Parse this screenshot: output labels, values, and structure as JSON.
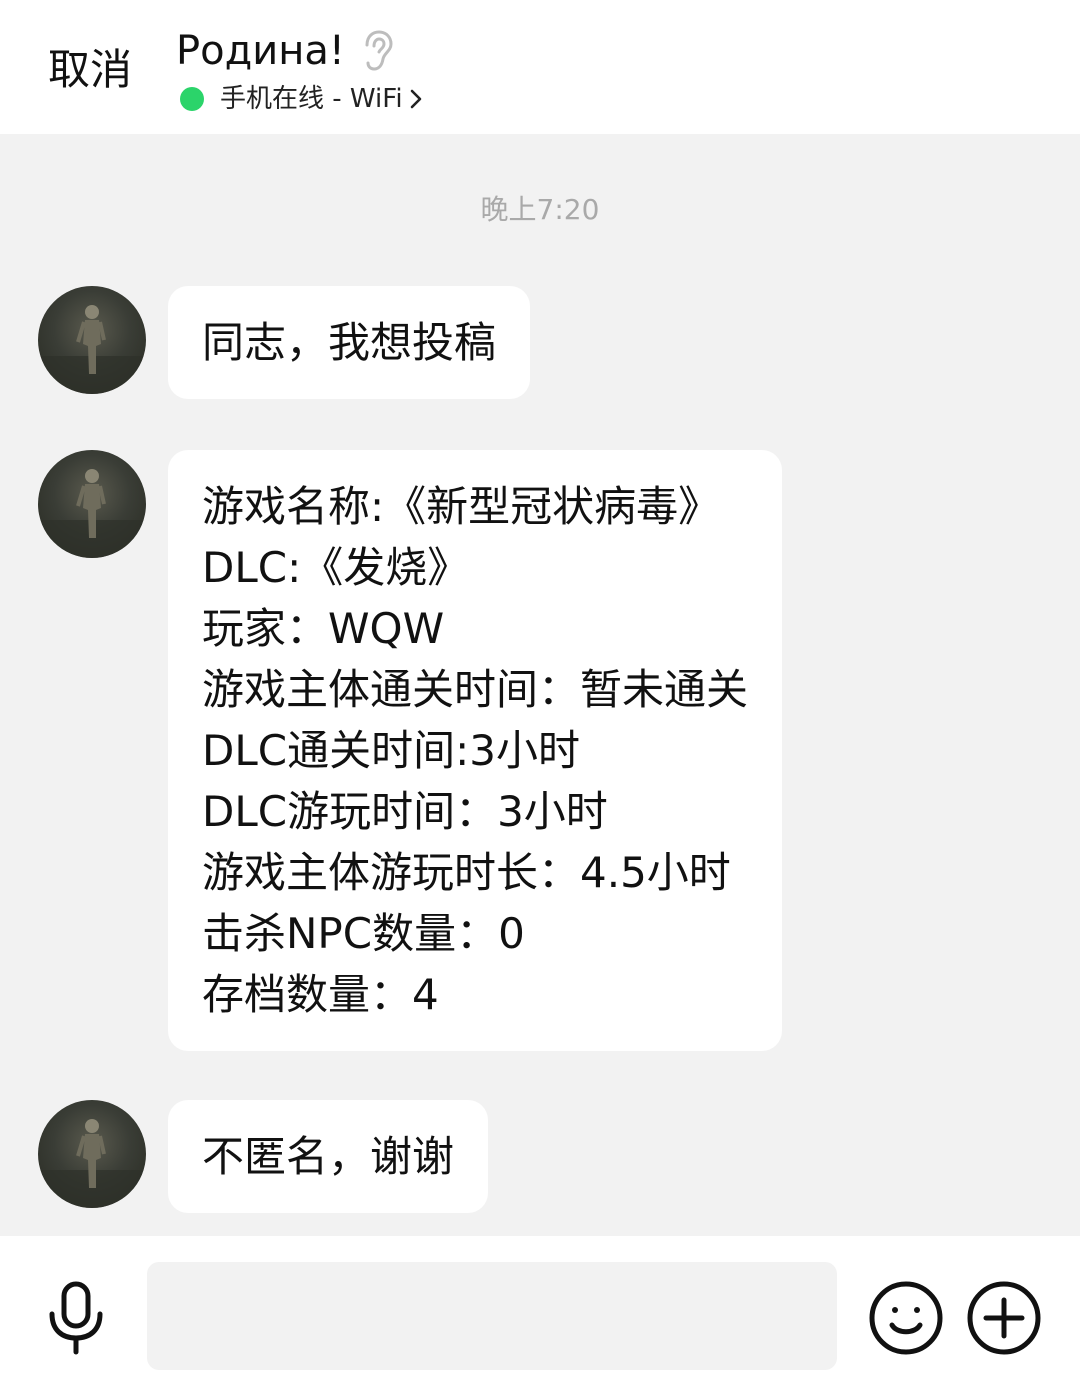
{
  "header": {
    "cancel_label": "取消",
    "title": "Родина!",
    "status_text": "手机在线 - WiFi",
    "status_color": "#2bd46a"
  },
  "chat": {
    "timestamp": "晚上7:20",
    "messages": [
      {
        "lines": [
          "同志，我想投稿"
        ]
      },
      {
        "lines": [
          "游戏名称:《新型冠状病毒》",
          "DLC:《发烧》",
          "玩家：WQW",
          "游戏主体通关时间：暂未通关",
          "DLC通关时间:3小时",
          "DLC游玩时间：3小时",
          "游戏主体游玩时长：4.5小时",
          "击杀NPC数量：0",
          "存档数量：4"
        ]
      },
      {
        "lines": [
          "不匿名，谢谢"
        ]
      }
    ]
  },
  "input": {
    "value": "",
    "placeholder": ""
  },
  "icons": {
    "ear": "ear-icon",
    "chevron": "chevron-right-icon",
    "mic": "microphone-icon",
    "emoji": "smiley-icon",
    "plus": "plus-circle-icon"
  }
}
